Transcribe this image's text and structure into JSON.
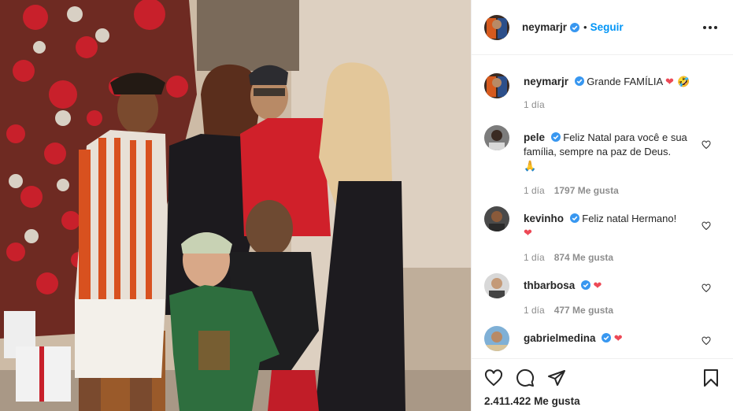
{
  "post": {
    "author": "neymarjr",
    "follow_label": "Seguir",
    "dot": "•",
    "caption_text": "Grande FAMÍLIA",
    "caption_emoji": "❤ 🤣",
    "caption_time": "1 día",
    "likes_total": "2.411.422 Me gusta"
  },
  "comments": [
    {
      "user": "pele",
      "verified": true,
      "text": "Feliz Natal para você e sua família, sempre na paz de Deus.",
      "emoji": "🙏",
      "time": "1 día",
      "likes": "1797 Me gusta"
    },
    {
      "user": "kevinho",
      "verified": true,
      "text": "Feliz natal Hermano!",
      "emoji": "❤",
      "time": "1 día",
      "likes": "874 Me gusta"
    },
    {
      "user": "thbarbosa",
      "verified": true,
      "text": "",
      "emoji": "❤",
      "time": "1 día",
      "likes": "477 Me gusta"
    },
    {
      "user": "gabrielmedina",
      "verified": true,
      "text": "",
      "emoji": "❤",
      "time": "",
      "likes": ""
    }
  ],
  "colors": {
    "accent_blue": "#0095f6",
    "heart_red": "#ed4956",
    "muted": "#8e8e8e"
  },
  "icons": [
    "verified-badge-icon",
    "more-options-icon",
    "heart-icon",
    "comment-icon",
    "share-icon",
    "bookmark-icon",
    "like-comment-icon"
  ]
}
